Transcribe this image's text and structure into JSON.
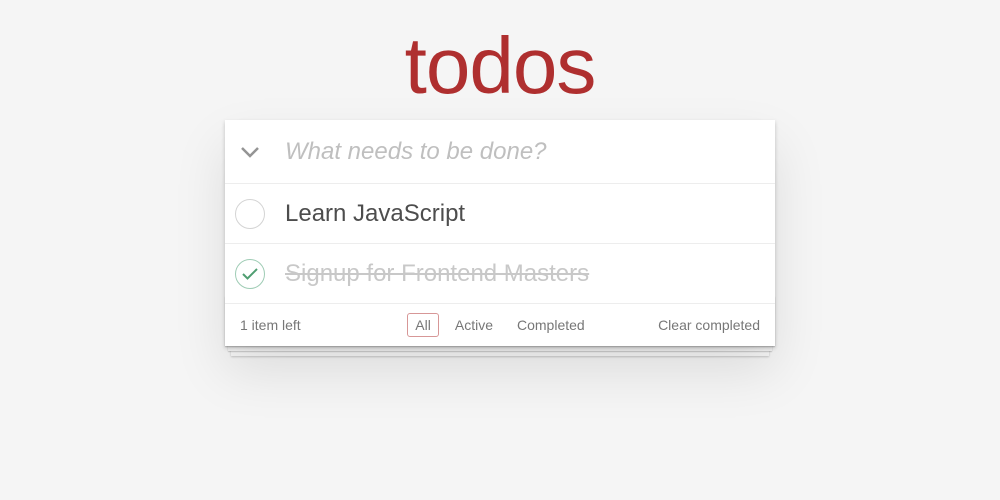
{
  "title": "todos",
  "header": {
    "placeholder": "What needs to be done?"
  },
  "items": [
    {
      "label": "Learn JavaScript",
      "completed": false
    },
    {
      "label": "Signup for Frontend Masters",
      "completed": true
    }
  ],
  "footer": {
    "count_text": "1 item left",
    "filters": [
      {
        "label": "All",
        "selected": true
      },
      {
        "label": "Active",
        "selected": false
      },
      {
        "label": "Completed",
        "selected": false
      }
    ],
    "clear_label": "Clear completed"
  }
}
